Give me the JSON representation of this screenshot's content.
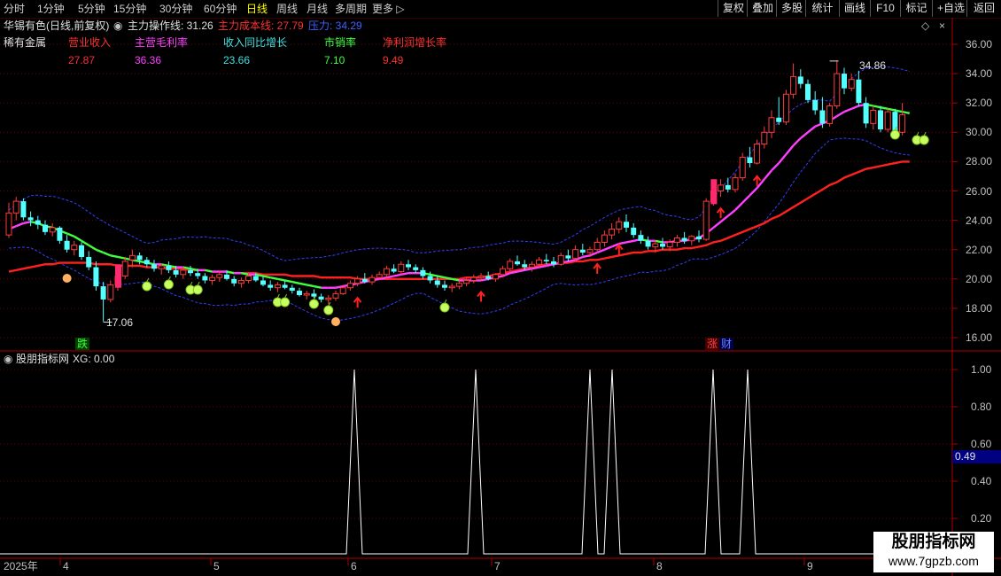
{
  "toolbar": {
    "periods": [
      "分时",
      "1分钟",
      "5分钟",
      "15分钟",
      "30分钟",
      "60分钟",
      "日线",
      "周线",
      "月线",
      "多周期",
      "更多 ▷"
    ],
    "active_period": "日线",
    "right_buttons": [
      "复权",
      "叠加",
      "多股",
      "统计",
      "画线",
      "F10",
      "标记",
      "+自选",
      "返回"
    ]
  },
  "header": {
    "stock_title": "华锡有色(日线,前复权)",
    "indicator_name": "主力操作线: 31.26",
    "cost_line": "主力成本线: 27.79",
    "pressure": "压力: 34.29",
    "sector": "稀有金属"
  },
  "fundamentals": [
    {
      "label": "营业收入",
      "value": "27.87",
      "label_color": "#ff3030",
      "value_color": "#ff3030"
    },
    {
      "label": "主营毛利率",
      "value": "36.36",
      "label_color": "#ff40ff",
      "value_color": "#ff40ff"
    },
    {
      "label": "收入同比增长",
      "value": "23.66",
      "label_color": "#40e0e0",
      "value_color": "#40e0e0"
    },
    {
      "label": "市销率",
      "value": "7.10",
      "label_color": "#40ff40",
      "value_color": "#40ff40"
    },
    {
      "label": "净利润增长率",
      "value": "9.49",
      "label_color": "#ff3030",
      "value_color": "#ff3030"
    }
  ],
  "price_axis": [
    "36.00",
    "34.00",
    "32.00",
    "30.00",
    "28.00",
    "26.00",
    "24.00",
    "22.00",
    "20.00",
    "18.00",
    "16.00"
  ],
  "annotations": {
    "low_label": "17.06",
    "high_label": "34.86",
    "die_label": "跌",
    "zhang_label": "涨",
    "cai_label": "财"
  },
  "sub_panel": {
    "title": "股朋指标网",
    "value_label": "XG: 0.00",
    "axis": [
      "1.00",
      "0.80",
      "0.60",
      "0.40",
      "0.20"
    ],
    "current_value": "0.49"
  },
  "date_axis": {
    "year": "2025年",
    "months": [
      "4",
      "5",
      "6",
      "7",
      "8",
      "9"
    ]
  },
  "watermark": {
    "title": "股朋指标网",
    "url": "www.7gpzb.com"
  },
  "colors": {
    "up": "#ff3c3c",
    "down": "#54ffff",
    "ma_magenta": "#ff40ff",
    "ma_green": "#40ff40",
    "cost_red": "#ff2020",
    "band_blue": "#3040ff",
    "axis_red": "#b00000"
  },
  "chart_data": {
    "type": "candlestick",
    "price_ylim": [
      15.0,
      37.0
    ],
    "sub_ylim": [
      0.0,
      1.1
    ],
    "signal_spikes_at_index": [
      48,
      68,
      83,
      86,
      100,
      105
    ],
    "ohlc": [
      [
        23.0,
        25.2,
        22.8,
        24.5
      ],
      [
        24.5,
        25.6,
        24.0,
        25.3
      ],
      [
        25.3,
        25.5,
        24.0,
        24.2
      ],
      [
        24.2,
        24.6,
        23.6,
        24.0
      ],
      [
        24.0,
        24.3,
        23.4,
        23.7
      ],
      [
        23.7,
        24.0,
        23.0,
        23.2
      ],
      [
        23.2,
        23.8,
        22.9,
        23.5
      ],
      [
        23.5,
        23.6,
        22.4,
        22.6
      ],
      [
        22.6,
        23.0,
        21.8,
        22.0
      ],
      [
        22.0,
        22.6,
        21.6,
        22.3
      ],
      [
        22.3,
        22.5,
        21.3,
        21.5
      ],
      [
        21.5,
        21.9,
        20.6,
        20.8
      ],
      [
        20.8,
        21.2,
        19.2,
        19.5
      ],
      [
        19.5,
        19.8,
        17.1,
        18.6
      ],
      [
        18.6,
        19.9,
        18.4,
        19.6
      ],
      [
        19.6,
        20.5,
        19.2,
        20.2
      ],
      [
        20.2,
        21.5,
        20.0,
        21.2
      ],
      [
        21.3,
        22.0,
        20.8,
        21.6
      ],
      [
        21.6,
        21.8,
        21.0,
        21.3
      ],
      [
        21.3,
        21.5,
        20.8,
        21.0
      ],
      [
        21.0,
        21.3,
        20.5,
        20.7
      ],
      [
        20.7,
        21.0,
        20.3,
        20.9
      ],
      [
        20.9,
        21.2,
        20.4,
        20.6
      ],
      [
        20.6,
        20.9,
        20.1,
        20.3
      ],
      [
        20.3,
        20.8,
        20.0,
        20.6
      ],
      [
        20.6,
        20.9,
        20.2,
        20.4
      ],
      [
        20.4,
        20.7,
        20.0,
        20.2
      ],
      [
        20.2,
        20.4,
        19.7,
        19.9
      ],
      [
        19.9,
        20.3,
        19.6,
        20.1
      ],
      [
        20.1,
        20.5,
        19.8,
        20.3
      ],
      [
        20.3,
        20.6,
        19.9,
        20.0
      ],
      [
        20.0,
        20.2,
        19.5,
        19.7
      ],
      [
        19.7,
        20.1,
        19.4,
        19.9
      ],
      [
        19.9,
        20.4,
        19.7,
        20.2
      ],
      [
        20.2,
        20.4,
        19.8,
        19.9
      ],
      [
        19.9,
        20.2,
        19.5,
        19.6
      ],
      [
        19.6,
        19.9,
        19.2,
        19.4
      ],
      [
        19.4,
        19.8,
        19.1,
        19.6
      ],
      [
        19.6,
        19.9,
        19.3,
        19.4
      ],
      [
        19.4,
        19.6,
        19.0,
        19.2
      ],
      [
        19.2,
        19.4,
        18.8,
        18.9
      ],
      [
        18.9,
        19.2,
        18.6,
        19.0
      ],
      [
        19.0,
        19.3,
        18.7,
        18.8
      ],
      [
        18.8,
        19.0,
        18.4,
        18.6
      ],
      [
        18.6,
        18.9,
        18.3,
        18.7
      ],
      [
        18.7,
        19.2,
        18.5,
        19.0
      ],
      [
        19.0,
        19.6,
        18.9,
        19.4
      ],
      [
        19.4,
        19.9,
        19.2,
        19.7
      ],
      [
        19.7,
        20.2,
        19.5,
        20.0
      ],
      [
        20.0,
        20.4,
        19.7,
        19.8
      ],
      [
        19.8,
        20.3,
        19.6,
        20.1
      ],
      [
        20.1,
        20.5,
        19.9,
        20.3
      ],
      [
        20.3,
        20.9,
        20.1,
        20.7
      ],
      [
        20.7,
        21.0,
        20.4,
        20.5
      ],
      [
        20.5,
        21.2,
        20.3,
        21.0
      ],
      [
        21.0,
        21.3,
        20.6,
        20.8
      ],
      [
        20.8,
        21.0,
        20.4,
        20.6
      ],
      [
        20.6,
        20.8,
        20.0,
        20.2
      ],
      [
        20.2,
        20.5,
        19.7,
        19.9
      ],
      [
        19.9,
        20.2,
        19.4,
        19.6
      ],
      [
        19.6,
        19.9,
        19.2,
        19.4
      ],
      [
        19.4,
        19.7,
        19.1,
        19.5
      ],
      [
        19.5,
        19.9,
        19.3,
        19.7
      ],
      [
        19.7,
        20.1,
        19.5,
        19.9
      ],
      [
        19.9,
        20.3,
        19.7,
        20.1
      ],
      [
        20.1,
        20.4,
        19.9,
        20.2
      ],
      [
        20.2,
        20.5,
        19.9,
        20.0
      ],
      [
        20.0,
        20.4,
        19.8,
        20.3
      ],
      [
        20.3,
        20.9,
        20.1,
        20.7
      ],
      [
        20.7,
        21.4,
        20.5,
        21.2
      ],
      [
        21.2,
        21.6,
        20.9,
        21.0
      ],
      [
        21.0,
        21.3,
        20.6,
        20.8
      ],
      [
        20.8,
        21.2,
        20.5,
        21.0
      ],
      [
        21.0,
        21.5,
        20.8,
        21.3
      ],
      [
        21.3,
        21.7,
        21.0,
        21.2
      ],
      [
        21.2,
        21.5,
        20.8,
        21.0
      ],
      [
        21.0,
        21.8,
        20.9,
        21.6
      ],
      [
        21.6,
        22.0,
        21.2,
        21.4
      ],
      [
        21.4,
        22.3,
        21.3,
        22.0
      ],
      [
        22.0,
        22.4,
        21.6,
        21.8
      ],
      [
        21.8,
        22.2,
        21.5,
        22.0
      ],
      [
        22.0,
        22.8,
        21.8,
        22.5
      ],
      [
        22.5,
        23.3,
        22.2,
        23.0
      ],
      [
        23.0,
        23.8,
        22.7,
        23.4
      ],
      [
        23.4,
        24.2,
        23.1,
        23.9
      ],
      [
        23.9,
        24.4,
        23.2,
        23.5
      ],
      [
        23.5,
        23.8,
        22.8,
        23.0
      ],
      [
        23.0,
        23.3,
        22.4,
        22.6
      ],
      [
        22.6,
        22.9,
        22.0,
        22.2
      ],
      [
        22.2,
        22.6,
        21.8,
        22.4
      ],
      [
        22.4,
        22.8,
        22.0,
        22.2
      ],
      [
        22.2,
        22.7,
        21.9,
        22.5
      ],
      [
        22.5,
        23.0,
        22.2,
        22.8
      ],
      [
        22.8,
        23.2,
        22.4,
        22.6
      ],
      [
        22.6,
        23.0,
        22.3,
        22.9
      ],
      [
        22.9,
        23.3,
        22.5,
        22.7
      ],
      [
        22.7,
        25.5,
        22.6,
        25.3
      ],
      [
        25.3,
        26.3,
        25.0,
        26.0
      ],
      [
        26.0,
        26.8,
        25.6,
        26.4
      ],
      [
        26.4,
        26.9,
        25.9,
        26.1
      ],
      [
        26.1,
        27.2,
        25.9,
        26.9
      ],
      [
        26.9,
        28.6,
        26.7,
        28.3
      ],
      [
        28.3,
        29.0,
        27.6,
        27.9
      ],
      [
        27.9,
        29.5,
        27.8,
        29.2
      ],
      [
        29.2,
        30.4,
        28.9,
        30.0
      ],
      [
        30.0,
        31.5,
        29.6,
        31.0
      ],
      [
        31.0,
        32.4,
        30.5,
        30.7
      ],
      [
        30.7,
        32.9,
        30.5,
        32.6
      ],
      [
        32.6,
        34.7,
        32.3,
        33.8
      ],
      [
        33.8,
        34.3,
        33.0,
        33.3
      ],
      [
        33.3,
        33.6,
        32.0,
        32.2
      ],
      [
        32.2,
        32.8,
        31.2,
        31.5
      ],
      [
        31.5,
        32.4,
        30.3,
        30.6
      ],
      [
        30.6,
        32.0,
        30.4,
        31.8
      ],
      [
        31.8,
        34.9,
        31.6,
        34.0
      ],
      [
        34.0,
        34.4,
        32.6,
        33.0
      ],
      [
        33.0,
        34.0,
        32.8,
        33.6
      ],
      [
        33.6,
        34.2,
        31.8,
        32.0
      ],
      [
        32.0,
        32.4,
        30.3,
        30.6
      ],
      [
        30.6,
        31.8,
        30.2,
        31.5
      ],
      [
        31.5,
        31.8,
        30.0,
        30.2
      ],
      [
        30.2,
        31.6,
        30.0,
        31.4
      ],
      [
        31.4,
        31.6,
        29.6,
        30.0
      ],
      [
        30.0,
        32.0,
        29.8,
        31.2
      ]
    ],
    "ma_line": [
      23.4,
      23.6,
      23.8,
      23.9,
      23.8,
      23.6,
      23.5,
      23.3,
      23.1,
      22.9,
      22.6,
      22.3,
      22.0,
      21.8,
      21.6,
      21.5,
      21.4,
      21.3,
      21.2,
      21.1,
      21.0,
      21.0,
      20.9,
      20.8,
      20.8,
      20.7,
      20.6,
      20.6,
      20.5,
      20.5,
      20.5,
      20.4,
      20.4,
      20.3,
      20.3,
      20.2,
      20.1,
      20.0,
      19.9,
      19.8,
      19.7,
      19.6,
      19.5,
      19.4,
      19.4,
      19.4,
      19.5,
      19.6,
      19.7,
      19.8,
      19.9,
      20.0,
      20.1,
      20.2,
      20.3,
      20.4,
      20.4,
      20.4,
      20.3,
      20.2,
      20.1,
      20.0,
      19.9,
      19.9,
      19.9,
      19.9,
      20.0,
      20.1,
      20.2,
      20.4,
      20.5,
      20.6,
      20.7,
      20.8,
      20.9,
      21.0,
      21.1,
      21.2,
      21.3,
      21.5,
      21.6,
      21.8,
      22.0,
      22.2,
      22.4,
      22.5,
      22.6,
      22.7,
      22.6,
      22.6,
      22.5,
      22.5,
      22.6,
      22.6,
      22.7,
      22.8,
      23.1,
      23.5,
      23.9,
      24.3,
      24.7,
      25.2,
      25.7,
      26.2,
      26.8,
      27.4,
      27.9,
      28.5,
      29.1,
      29.6,
      30.0,
      30.4,
      30.6,
      30.8,
      31.1,
      31.4,
      31.6,
      31.8,
      31.9,
      31.8,
      31.7,
      31.6,
      31.5,
      31.4,
      31.3
    ],
    "cost_line": [
      20.5,
      20.6,
      20.7,
      20.8,
      20.9,
      21.0,
      21.0,
      21.1,
      21.1,
      21.1,
      21.1,
      21.1,
      21.0,
      21.0,
      21.0,
      20.9,
      20.9,
      20.9,
      20.9,
      20.8,
      20.8,
      20.8,
      20.7,
      20.7,
      20.7,
      20.6,
      20.6,
      20.6,
      20.5,
      20.5,
      20.5,
      20.4,
      20.4,
      20.4,
      20.4,
      20.3,
      20.3,
      20.3,
      20.3,
      20.2,
      20.2,
      20.2,
      20.2,
      20.1,
      20.1,
      20.1,
      20.1,
      20.1,
      20.0,
      20.0,
      20.0,
      20.0,
      20.0,
      20.0,
      20.0,
      20.0,
      20.0,
      20.0,
      20.0,
      20.0,
      20.0,
      20.0,
      20.0,
      20.1,
      20.1,
      20.1,
      20.2,
      20.3,
      20.4,
      20.5,
      20.6,
      20.7,
      20.8,
      20.9,
      21.0,
      21.0,
      21.1,
      21.1,
      21.2,
      21.2,
      21.3,
      21.3,
      21.4,
      21.5,
      21.6,
      21.7,
      21.8,
      21.8,
      21.9,
      21.9,
      22.0,
      22.0,
      22.0,
      22.1,
      22.1,
      22.2,
      22.3,
      22.5,
      22.6,
      22.8,
      23.0,
      23.2,
      23.4,
      23.6,
      23.8,
      24.1,
      24.3,
      24.6,
      24.9,
      25.2,
      25.5,
      25.8,
      26.1,
      26.4,
      26.6,
      26.9,
      27.1,
      27.3,
      27.5,
      27.6,
      27.7,
      27.8,
      27.9,
      28.0,
      28.0
    ]
  }
}
